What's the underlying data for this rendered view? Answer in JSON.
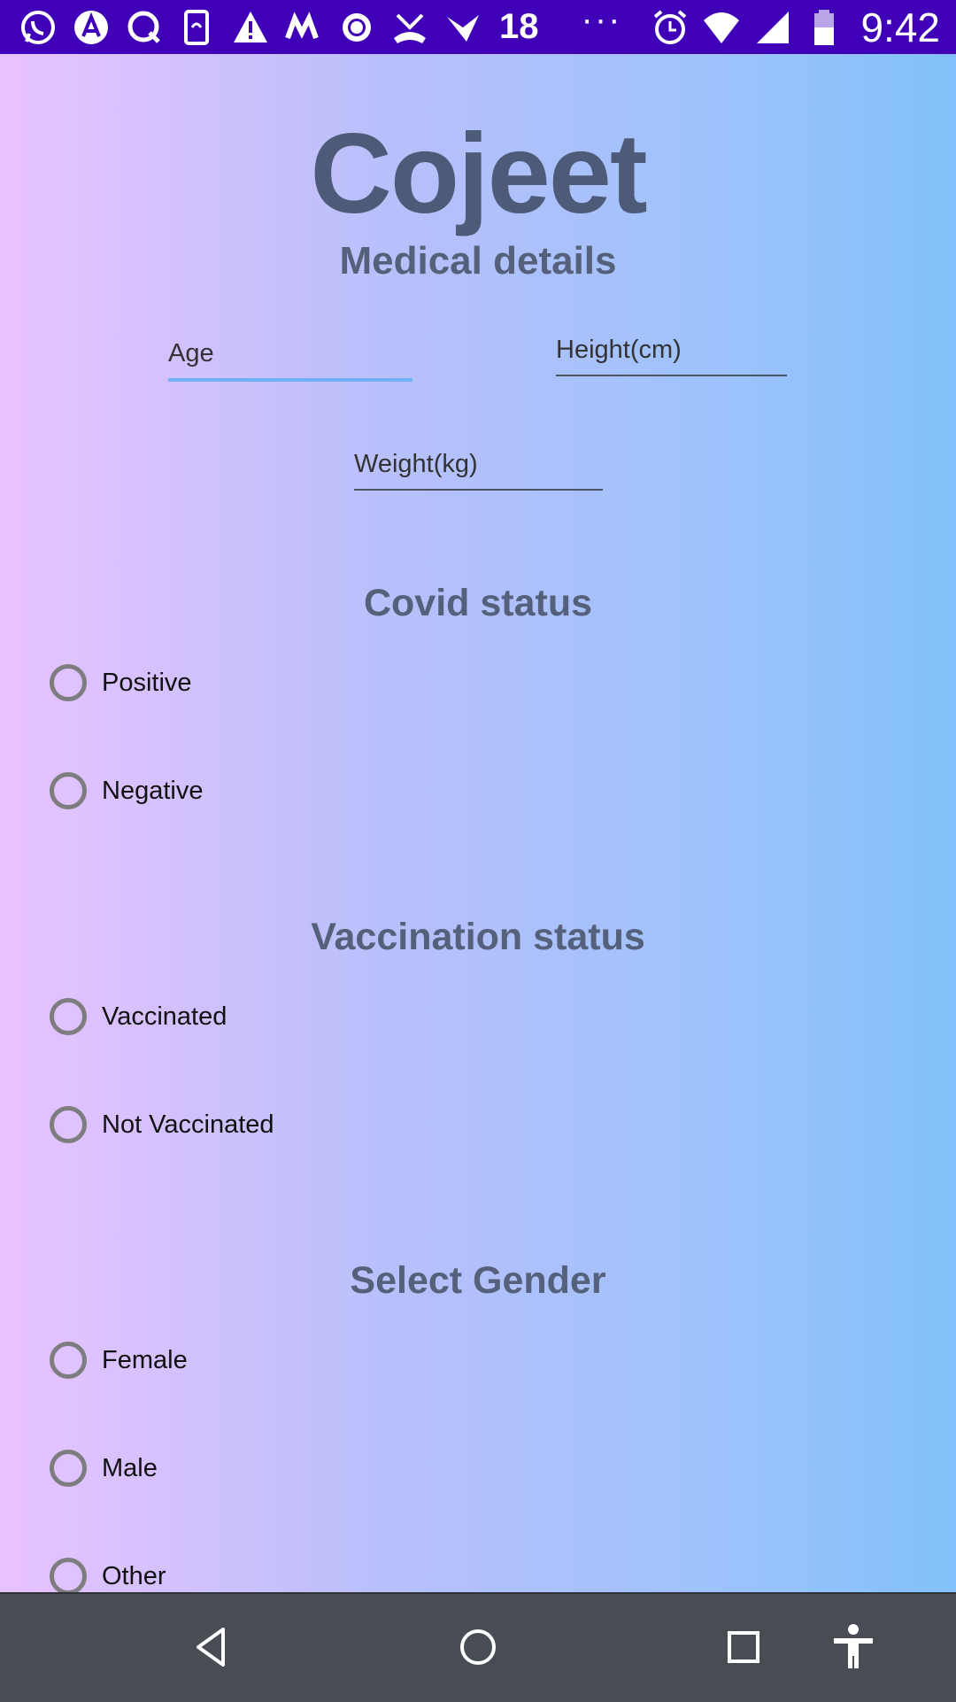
{
  "status_bar": {
    "notification_count": "18",
    "more_indicator": "···",
    "time": "9:42",
    "left_icons": [
      "whatsapp-icon",
      "aptoide-icon",
      "qbot-icon",
      "phone-sync-icon",
      "warning-icon",
      "mi-icon",
      "brightness-icon",
      "missed-call-icon",
      "swipe-icon"
    ],
    "right_icons": [
      "alarm-icon",
      "wifi-icon",
      "signal-icon",
      "battery-icon"
    ]
  },
  "app": {
    "title": "Cojeet",
    "subtitle": "Medical details"
  },
  "form": {
    "age": {
      "placeholder": "Age",
      "value": ""
    },
    "height": {
      "placeholder": "Height(cm)",
      "value": ""
    },
    "weight": {
      "placeholder": "Weight(kg)",
      "value": ""
    }
  },
  "covid": {
    "title": "Covid status",
    "options": [
      "Positive",
      "Negative"
    ]
  },
  "vaccination": {
    "title": "Vaccination status",
    "options": [
      "Vaccinated",
      "Not Vaccinated"
    ]
  },
  "gender": {
    "title": "Select Gender",
    "options": [
      "Female",
      "Male",
      "Other"
    ]
  },
  "colors": {
    "status_bar": "#3f00b8",
    "title_text": "#4e5b78",
    "nav_bar": "#474d53",
    "focus_underline": "#6fb0f7"
  }
}
